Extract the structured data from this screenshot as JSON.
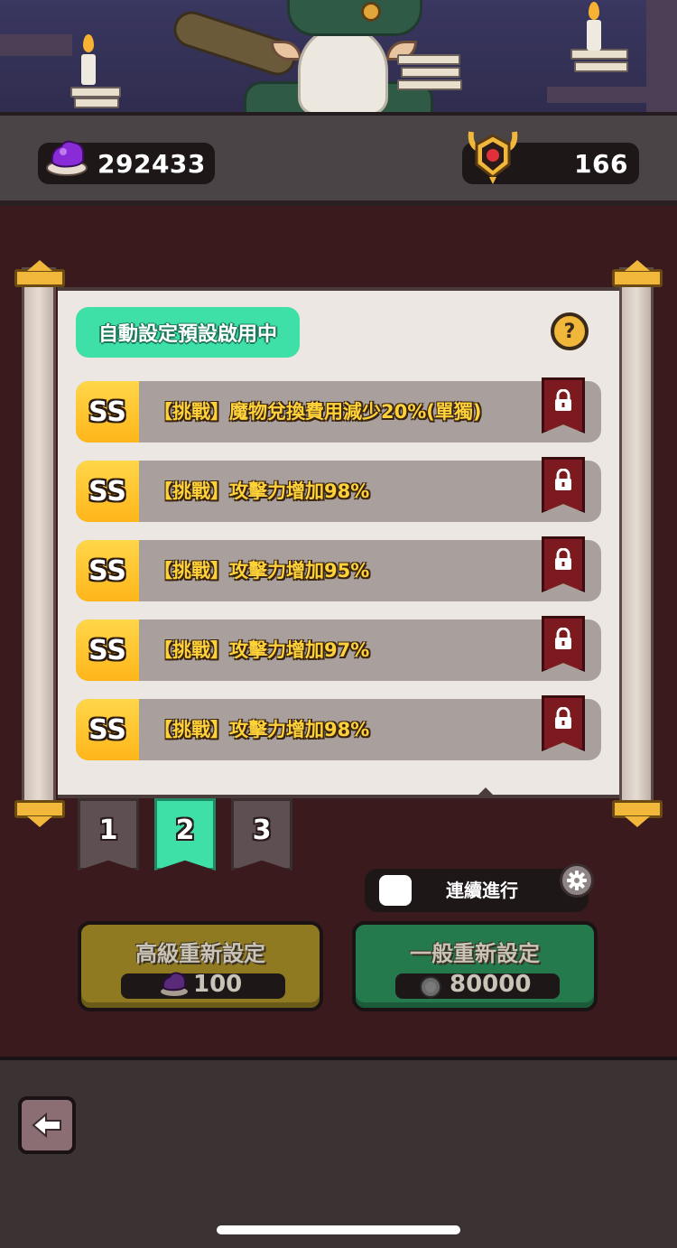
{
  "resources": {
    "gems": "292433",
    "trophies": "166"
  },
  "panel": {
    "preset_badge": "自動設定預設啟用中",
    "help_label": "?",
    "options": [
      {
        "grade": "SS",
        "text": "【挑戰】魔物兌換費用減少20%(單獨)"
      },
      {
        "grade": "SS",
        "text": "【挑戰】攻擊力增加98%"
      },
      {
        "grade": "SS",
        "text": "【挑戰】攻擊力增加95%"
      },
      {
        "grade": "SS",
        "text": "【挑戰】攻擊力增加97%"
      },
      {
        "grade": "SS",
        "text": "【挑戰】攻擊力增加98%"
      }
    ]
  },
  "preset_tabs": [
    {
      "label": "1",
      "active": false
    },
    {
      "label": "2",
      "active": true
    },
    {
      "label": "3",
      "active": false
    }
  ],
  "continuous": {
    "label": "連續進行",
    "checked": false
  },
  "reset": {
    "advanced": {
      "title": "高級重新設定",
      "cost": "100"
    },
    "normal": {
      "title": "一般重新設定",
      "cost": "80000"
    }
  },
  "colors": {
    "accent_green": "#3fe0a8",
    "grade_gold": "#ffc62a",
    "lock_red": "#7d1a20",
    "option_text": "#ffd23a"
  },
  "icons": {
    "gem": "purple-gem-icon",
    "trophy": "horned-emblem-icon",
    "lock": "padlock-icon",
    "settings": "gear-icon",
    "back": "left-arrow-icon",
    "coin": "coin-icon"
  }
}
